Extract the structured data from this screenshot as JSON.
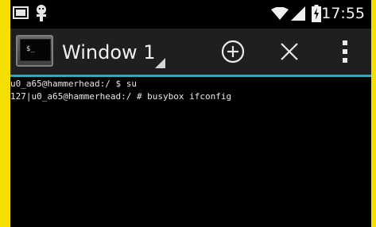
{
  "status_bar": {
    "time": "17:55",
    "left_icons": [
      "screenshot-icon",
      "android-debug-icon"
    ],
    "right_icons": [
      "wifi-icon",
      "signal-icon",
      "battery-icon"
    ]
  },
  "action_bar": {
    "window_title": "Window 1",
    "actions": [
      "add-window-icon",
      "close-window-icon",
      "overflow-menu-icon"
    ],
    "accent_color": "#2fa8c8"
  },
  "terminal": {
    "lines": [
      "u0_a65@hammerhead:/ $ su",
      "127|u0_a65@hammerhead:/ # busybox ifconfig"
    ],
    "cursor_prompt": "$_"
  }
}
